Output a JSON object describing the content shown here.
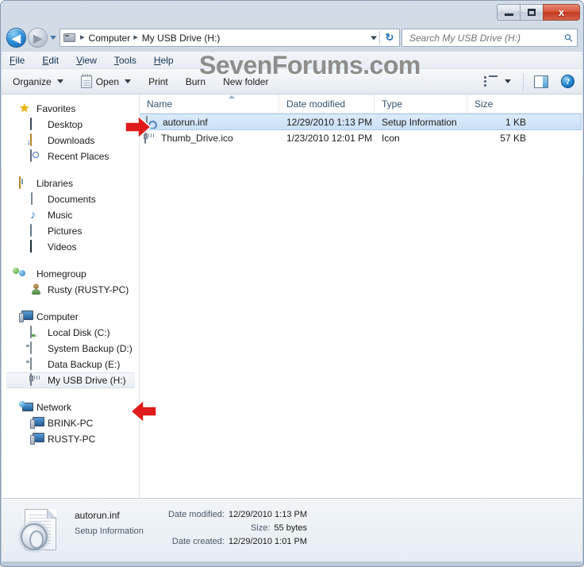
{
  "window": {
    "controls": {
      "minimize_label": "−",
      "maximize_label": "",
      "close_label": "x"
    }
  },
  "addressbar": {
    "back_label": "◀",
    "forward_label": "▶",
    "breadcrumbs": [
      "Computer",
      "My USB Drive (H:)"
    ],
    "separator": "▸",
    "refresh_label": "↻"
  },
  "search": {
    "placeholder": "Search My USB Drive (H:)",
    "value": "",
    "icon_label": "⚲"
  },
  "menubar": {
    "items": [
      {
        "pre": "",
        "key": "F",
        "post": "ile"
      },
      {
        "pre": "",
        "key": "E",
        "post": "dit"
      },
      {
        "pre": "",
        "key": "V",
        "post": "iew"
      },
      {
        "pre": "",
        "key": "T",
        "post": "ools"
      },
      {
        "pre": "",
        "key": "H",
        "post": "elp"
      }
    ]
  },
  "watermark": {
    "text": "SevenForums.com"
  },
  "toolbar": {
    "organize_label": "Organize",
    "open_label": "Open",
    "print_label": "Print",
    "burn_label": "Burn",
    "newfolder_label": "New folder",
    "help_label": "?"
  },
  "navpane": {
    "groups": [
      {
        "header": {
          "label": "Favorites",
          "icon": "star-icon"
        },
        "items": [
          {
            "label": "Desktop",
            "icon": "desktop-icon"
          },
          {
            "label": "Downloads",
            "icon": "downloads-folder-icon"
          },
          {
            "label": "Recent Places",
            "icon": "recent-places-icon"
          }
        ]
      },
      {
        "header": {
          "label": "Libraries",
          "icon": "libraries-icon"
        },
        "items": [
          {
            "label": "Documents",
            "icon": "document-icon"
          },
          {
            "label": "Music",
            "icon": "music-note-icon"
          },
          {
            "label": "Pictures",
            "icon": "picture-icon"
          },
          {
            "label": "Videos",
            "icon": "video-icon"
          }
        ]
      },
      {
        "header": {
          "label": "Homegroup",
          "icon": "homegroup-icon"
        },
        "items": [
          {
            "label": "Rusty (RUSTY-PC)",
            "icon": "user-icon"
          }
        ]
      },
      {
        "header": {
          "label": "Computer",
          "icon": "computer-icon"
        },
        "items": [
          {
            "label": "Local Disk (C:)",
            "icon": "hard-drive-icon"
          },
          {
            "label": "System Backup (D:)",
            "icon": "drive-icon"
          },
          {
            "label": "Data Backup (E:)",
            "icon": "drive-icon"
          },
          {
            "label": "My USB Drive (H:)",
            "icon": "usb-drive-icon",
            "selected": true
          }
        ]
      },
      {
        "header": {
          "label": "Network",
          "icon": "network-icon"
        },
        "items": [
          {
            "label": "BRINK-PC",
            "icon": "pc-icon"
          },
          {
            "label": "RUSTY-PC",
            "icon": "pc-icon"
          }
        ]
      }
    ]
  },
  "filelist": {
    "columns": [
      "Name",
      "Date modified",
      "Type",
      "Size"
    ],
    "sorted_by": "Name",
    "rows": [
      {
        "name": "autorun.inf",
        "date_modified": "12/29/2010 1:13 PM",
        "type": "Setup Information",
        "size": "1 KB",
        "icon": "setup-information-icon",
        "selected": true
      },
      {
        "name": "Thumb_Drive.ico",
        "date_modified": "1/23/2010 12:01 PM",
        "type": "Icon",
        "size": "57 KB",
        "icon": "icon-file-icon",
        "selected": false
      }
    ]
  },
  "details": {
    "filename": "autorun.inf",
    "filetype": "Setup Information",
    "fields": [
      {
        "label": "Date modified:",
        "value": "12/29/2010 1:13 PM"
      },
      {
        "label": "Size:",
        "value": "55 bytes"
      },
      {
        "label": "Date created:",
        "value": "12/29/2010 1:01 PM"
      }
    ]
  },
  "annotations": {
    "arrow_color": "#e01b1b",
    "arrows": [
      {
        "name": "arrow-pointing-to-autorun-file",
        "direction": "right"
      },
      {
        "name": "arrow-pointing-to-usb-drive",
        "direction": "left"
      }
    ]
  }
}
